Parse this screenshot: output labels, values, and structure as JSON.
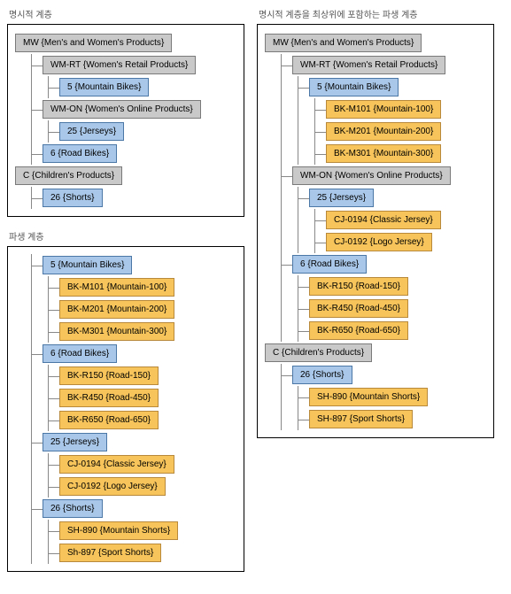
{
  "top_left": {
    "title": "명시적 계층",
    "nodes": [
      {
        "depth": 0,
        "color": "grey",
        "code": "MW",
        "label": "Men's and Women's Products"
      },
      {
        "depth": 1,
        "color": "grey",
        "code": "WM-RT",
        "label": "Women's Retail Products"
      },
      {
        "depth": 2,
        "color": "blue",
        "code": "5",
        "label": "Mountain Bikes"
      },
      {
        "depth": 1,
        "color": "grey",
        "code": "WM-ON",
        "label": "Women's Online Products"
      },
      {
        "depth": 2,
        "color": "blue",
        "code": "25",
        "label": "Jerseys"
      },
      {
        "depth": 1,
        "color": "blue",
        "code": "6",
        "label": "Road Bikes"
      },
      {
        "depth": 0,
        "color": "grey",
        "code": "C",
        "label": "Children's Products"
      },
      {
        "depth": 1,
        "color": "blue",
        "code": "26",
        "label": "Shorts"
      }
    ]
  },
  "bottom_left": {
    "title": "파생 계층",
    "nodes": [
      {
        "depth": 1,
        "color": "blue",
        "code": "5",
        "label": "Mountain Bikes"
      },
      {
        "depth": 2,
        "color": "orange",
        "code": "BK-M101",
        "label": "Mountain-100"
      },
      {
        "depth": 2,
        "color": "orange",
        "code": "BK-M201",
        "label": "Mountain-200"
      },
      {
        "depth": 2,
        "color": "orange",
        "code": "BK-M301",
        "label": "Mountain-300"
      },
      {
        "depth": 1,
        "color": "blue",
        "code": "6",
        "label": "Road Bikes"
      },
      {
        "depth": 2,
        "color": "orange",
        "code": "BK-R150",
        "label": "Road-150"
      },
      {
        "depth": 2,
        "color": "orange",
        "code": "BK-R450",
        "label": "Road-450"
      },
      {
        "depth": 2,
        "color": "orange",
        "code": "BK-R650",
        "label": "Road-650"
      },
      {
        "depth": 1,
        "color": "blue",
        "code": "25",
        "label": "Jerseys"
      },
      {
        "depth": 2,
        "color": "orange",
        "code": "CJ-0194",
        "label": "Classic Jersey"
      },
      {
        "depth": 2,
        "color": "orange",
        "code": "CJ-0192",
        "label": "Logo Jersey"
      },
      {
        "depth": 1,
        "color": "blue",
        "code": "26",
        "label": "Shorts"
      },
      {
        "depth": 2,
        "color": "orange",
        "code": "SH-890",
        "label": "Mountain Shorts"
      },
      {
        "depth": 2,
        "color": "orange",
        "code": "Sh-897",
        "label": "Sport Shorts"
      }
    ]
  },
  "right": {
    "title": "명시적 계층을 최상위에 포함하는 파생 계층",
    "nodes": [
      {
        "depth": 0,
        "color": "grey",
        "code": "MW",
        "label": "Men's and Women's Products"
      },
      {
        "depth": 1,
        "color": "grey",
        "code": "WM-RT",
        "label": "Women's Retail Products"
      },
      {
        "depth": 2,
        "color": "blue",
        "code": "5",
        "label": "Mountain Bikes"
      },
      {
        "depth": 3,
        "color": "orange",
        "code": "BK-M101",
        "label": "Mountain-100"
      },
      {
        "depth": 3,
        "color": "orange",
        "code": "BK-M201",
        "label": "Mountain-200"
      },
      {
        "depth": 3,
        "color": "orange",
        "code": "BK-M301",
        "label": "Mountain-300"
      },
      {
        "depth": 1,
        "color": "grey",
        "code": "WM-ON",
        "label": "Women's Online Products"
      },
      {
        "depth": 2,
        "color": "blue",
        "code": "25",
        "label": "Jerseys"
      },
      {
        "depth": 3,
        "color": "orange",
        "code": "CJ-0194",
        "label": "Classic Jersey"
      },
      {
        "depth": 3,
        "color": "orange",
        "code": "CJ-0192",
        "label": "Logo Jersey"
      },
      {
        "depth": 1,
        "color": "blue",
        "code": "6",
        "label": "Road Bikes"
      },
      {
        "depth": 2,
        "color": "orange",
        "code": "BK-R150",
        "label": "Road-150"
      },
      {
        "depth": 2,
        "color": "orange",
        "code": "BK-R450",
        "label": "Road-450"
      },
      {
        "depth": 2,
        "color": "orange",
        "code": "BK-R650",
        "label": "Road-650"
      },
      {
        "depth": 0,
        "color": "grey",
        "code": "C",
        "label": "Children's Products"
      },
      {
        "depth": 1,
        "color": "blue",
        "code": "26",
        "label": "Shorts"
      },
      {
        "depth": 2,
        "color": "orange",
        "code": "SH-890",
        "label": "Mountain Shorts"
      },
      {
        "depth": 2,
        "color": "orange",
        "code": "SH-897",
        "label": "Sport Shorts"
      }
    ]
  },
  "chart_data": {
    "type": "table",
    "title": "Hierarchy diagrams",
    "panels": [
      {
        "name": "명시적 계층",
        "tree": [
          {
            "code": "MW",
            "label": "Men's and Women's Products",
            "children": [
              {
                "code": "WM-RT",
                "label": "Women's Retail Products",
                "children": [
                  {
                    "code": "5",
                    "label": "Mountain Bikes"
                  }
                ]
              },
              {
                "code": "WM-ON",
                "label": "Women's Online Products",
                "children": [
                  {
                    "code": "25",
                    "label": "Jerseys"
                  }
                ]
              },
              {
                "code": "6",
                "label": "Road Bikes"
              }
            ]
          },
          {
            "code": "C",
            "label": "Children's Products",
            "children": [
              {
                "code": "26",
                "label": "Shorts"
              }
            ]
          }
        ]
      },
      {
        "name": "파생 계층",
        "tree": [
          {
            "code": "5",
            "label": "Mountain Bikes",
            "children": [
              {
                "code": "BK-M101",
                "label": "Mountain-100"
              },
              {
                "code": "BK-M201",
                "label": "Mountain-200"
              },
              {
                "code": "BK-M301",
                "label": "Mountain-300"
              }
            ]
          },
          {
            "code": "6",
            "label": "Road Bikes",
            "children": [
              {
                "code": "BK-R150",
                "label": "Road-150"
              },
              {
                "code": "BK-R450",
                "label": "Road-450"
              },
              {
                "code": "BK-R650",
                "label": "Road-650"
              }
            ]
          },
          {
            "code": "25",
            "label": "Jerseys",
            "children": [
              {
                "code": "CJ-0194",
                "label": "Classic Jersey"
              },
              {
                "code": "CJ-0192",
                "label": "Logo Jersey"
              }
            ]
          },
          {
            "code": "26",
            "label": "Shorts",
            "children": [
              {
                "code": "SH-890",
                "label": "Mountain Shorts"
              },
              {
                "code": "Sh-897",
                "label": "Sport Shorts"
              }
            ]
          }
        ]
      },
      {
        "name": "명시적 계층을 최상위에 포함하는 파생 계층",
        "tree": [
          {
            "code": "MW",
            "label": "Men's and Women's Products",
            "children": [
              {
                "code": "WM-RT",
                "label": "Women's Retail Products",
                "children": [
                  {
                    "code": "5",
                    "label": "Mountain Bikes",
                    "children": [
                      {
                        "code": "BK-M101",
                        "label": "Mountain-100"
                      },
                      {
                        "code": "BK-M201",
                        "label": "Mountain-200"
                      },
                      {
                        "code": "BK-M301",
                        "label": "Mountain-300"
                      }
                    ]
                  }
                ]
              },
              {
                "code": "WM-ON",
                "label": "Women's Online Products",
                "children": [
                  {
                    "code": "25",
                    "label": "Jerseys",
                    "children": [
                      {
                        "code": "CJ-0194",
                        "label": "Classic Jersey"
                      },
                      {
                        "code": "CJ-0192",
                        "label": "Logo Jersey"
                      }
                    ]
                  }
                ]
              },
              {
                "code": "6",
                "label": "Road Bikes",
                "children": [
                  {
                    "code": "BK-R150",
                    "label": "Road-150"
                  },
                  {
                    "code": "BK-R450",
                    "label": "Road-450"
                  },
                  {
                    "code": "BK-R650",
                    "label": "Road-650"
                  }
                ]
              }
            ]
          },
          {
            "code": "C",
            "label": "Children's Products",
            "children": [
              {
                "code": "26",
                "label": "Shorts",
                "children": [
                  {
                    "code": "SH-890",
                    "label": "Mountain Shorts"
                  },
                  {
                    "code": "SH-897",
                    "label": "Sport Shorts"
                  }
                ]
              }
            ]
          }
        ]
      }
    ]
  }
}
